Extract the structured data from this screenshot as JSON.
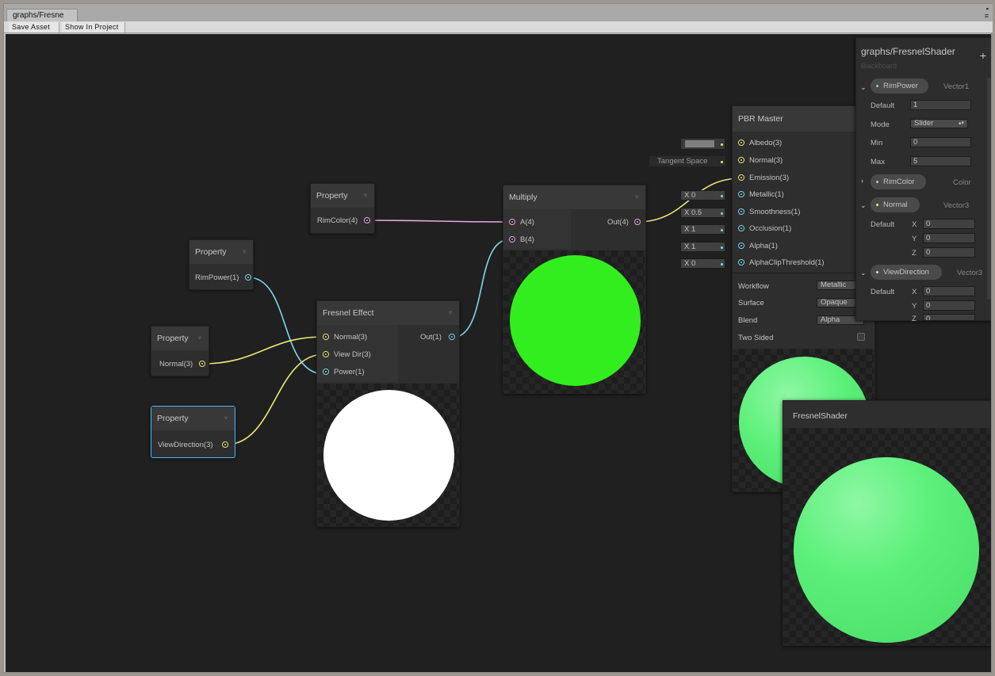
{
  "window": {
    "tab_title": "graphs/Fresne",
    "toolbar": {
      "save_asset": "Save Asset",
      "show_in_project": "Show In Project"
    }
  },
  "nodes": {
    "rimcolor_prop": {
      "title": "Property",
      "out": "RimColor(4)"
    },
    "rimpower_prop": {
      "title": "Property",
      "out": "RimPower(1)"
    },
    "normal_prop": {
      "title": "Property",
      "out": "Normal(3)"
    },
    "viewdir_prop": {
      "title": "Property",
      "out": "ViewDirection(3)"
    },
    "fresnel": {
      "title": "Fresnel Effect",
      "in": [
        "Normal(3)",
        "View Dir(3)",
        "Power(1)"
      ],
      "out": "Out(1)"
    },
    "multiply": {
      "title": "Multiply",
      "in": [
        "A(4)",
        "B(4)"
      ],
      "out": "Out(4)"
    },
    "pbr": {
      "title": "PBR Master",
      "inputs": [
        "Albedo(3)",
        "Normal(3)",
        "Emission(3)",
        "Metallic(1)",
        "Smoothness(1)",
        "Occlusion(1)",
        "Alpha(1)",
        "AlphaClipThreshold(1)"
      ],
      "defaults": {
        "normal": "Tangent Space",
        "metallic": "X 0",
        "smoothness": "X 0.5",
        "occlusion": "X 1",
        "alpha": "X 1",
        "alphaclip": "X 0"
      },
      "settings": [
        {
          "label": "Workflow",
          "value": "Metallic"
        },
        {
          "label": "Surface",
          "value": "Opaque"
        },
        {
          "label": "Blend",
          "value": "Alpha"
        }
      ],
      "two_sided": "Two Sided"
    }
  },
  "blackboard": {
    "title": "graphs/FresnelShader",
    "subtitle": "Blackboard",
    "add": "+",
    "props": [
      {
        "name": "RimPower",
        "type": "Vector1"
      },
      {
        "name": "RimColor",
        "type": "Color"
      },
      {
        "name": "Normal",
        "type": "Vector3"
      },
      {
        "name": "ViewDirection",
        "type": "Vector3"
      }
    ],
    "rimpower_fields": {
      "default_label": "Default",
      "default": "1",
      "mode_label": "Mode",
      "mode": "Slider",
      "min_label": "Min",
      "min": "0",
      "max_label": "Max",
      "max": "5"
    },
    "normal_fields": {
      "default_label": "Default",
      "x": "X",
      "y": "Y",
      "z": "Z",
      "xv": "0",
      "yv": "0",
      "zv": "0"
    },
    "viewdir_fields": {
      "default_label": "Default",
      "x": "X",
      "y": "Y",
      "z": "Z",
      "xv": "0",
      "yv": "0",
      "zv": "0"
    }
  },
  "main_preview": {
    "title": "FresnelShader"
  },
  "colors": {
    "wire_vector1": "#7fd6ee",
    "wire_vector3": "#e8e87a",
    "wire_vector4": "#e8a8e4",
    "multiply_preview": "#33ee1e",
    "fresnel_preview": "#ffffff",
    "master_preview": "#5cf07a",
    "selection": "#4fb7ff"
  }
}
